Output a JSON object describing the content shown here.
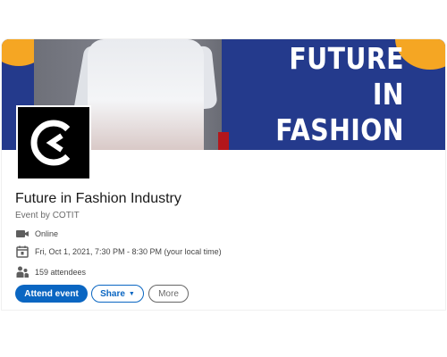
{
  "banner": {
    "headline": "FUTURE IN\nFASHION\nINDUSTRY",
    "brand_color": "#243a8c",
    "accent_color": "#f5a623"
  },
  "event": {
    "title": "Future in Fashion Industry",
    "organizer": "Event by COTIT",
    "location": "Online",
    "datetime": "Fri, Oct 1, 2021, 7:30 PM - 8:30 PM (your local time)",
    "attendees": "159 attendees"
  },
  "icons": {
    "location": "video-camera-icon",
    "datetime": "calendar-icon",
    "attendees": "people-icon"
  },
  "actions": {
    "attend_label": "Attend event",
    "share_label": "Share",
    "more_label": "More",
    "primary_color": "#0a66c2"
  }
}
